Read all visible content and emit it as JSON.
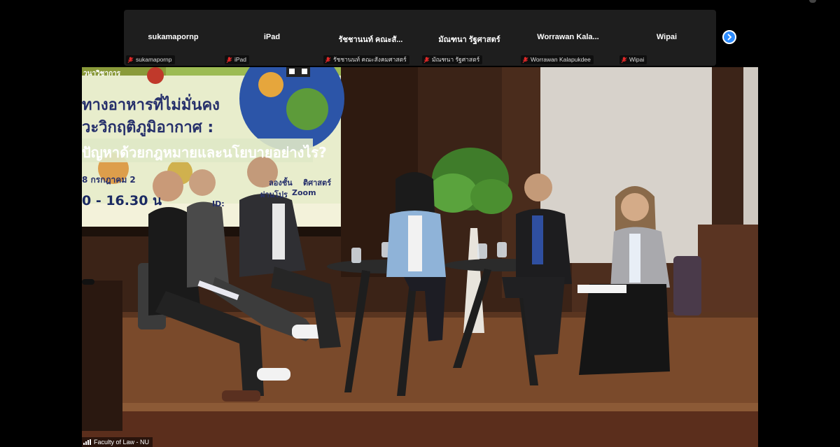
{
  "participants": [
    {
      "display": "sukamapornp",
      "label": "sukamapornp"
    },
    {
      "display": "iPad",
      "label": "iPad"
    },
    {
      "display": "รัชชานนท์ คณะสั...",
      "label": "รัชชานนท์ คณะสังคมศาสตร์"
    },
    {
      "display": "มัณฑนา รัฐศาสตร์",
      "label": "มัณฑนา รัฐศาสตร์"
    },
    {
      "display": "Worrawan  Kala...",
      "label": "Worrawan Kalapukdee"
    },
    {
      "display": "Wipai",
      "label": "Wipai"
    }
  ],
  "controls": {
    "next_participants_icon": "chevron-right-icon",
    "muted_icon": "mic-muted-icon",
    "accent_color": "#2d8cff",
    "muted_color": "#e02828"
  },
  "main_video": {
    "speaker_label": "Faculty of Law - NU",
    "slide": {
      "line_header": "วนาวิชาการ",
      "line1": "ทางอาหารที่ไม่มั่นคง",
      "line2": "วะวิกฤติภูมิอากาศ :",
      "line3": "ปัญหาด้วยกฎหมายและนโยบายอย่างไร?",
      "date": "8 กรกฎาคม 2",
      "room": "ลองชั้น",
      "faculty": "ติศาสตร์",
      "via": "ผ่านโปร",
      "zoom": "Zoom",
      "time": "0 - 16.30 น",
      "id_label": "ID:"
    }
  }
}
